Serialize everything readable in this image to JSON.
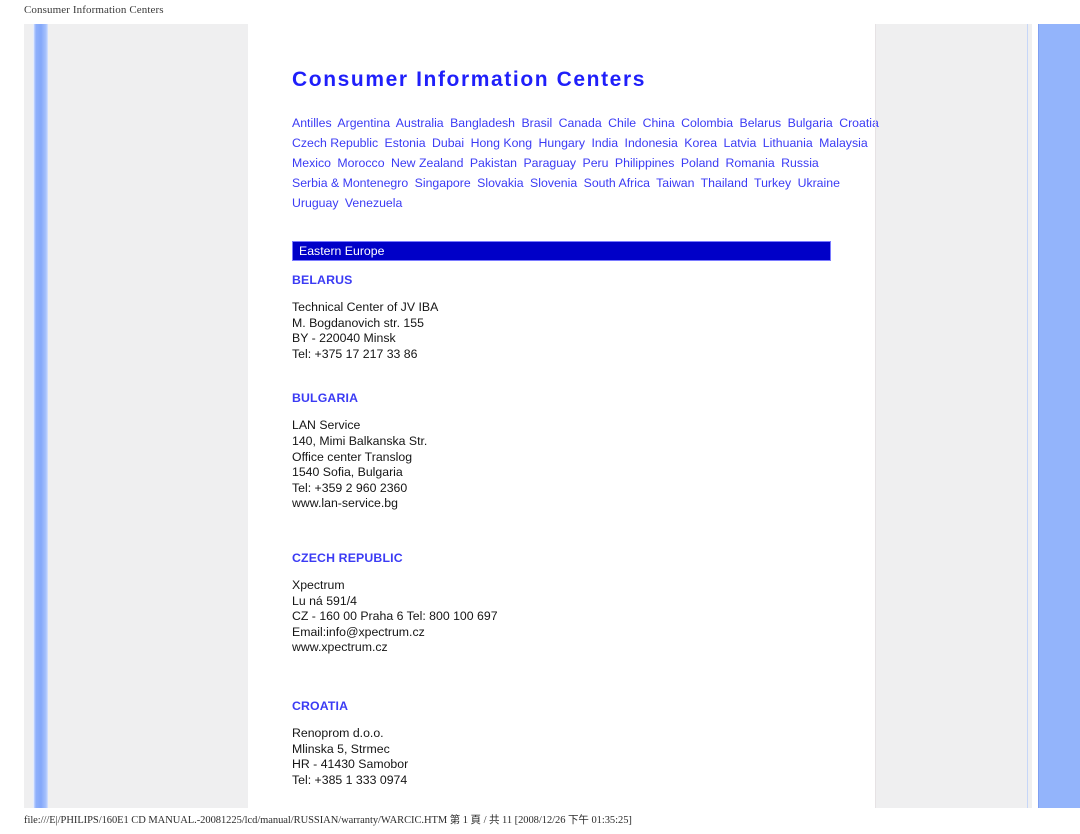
{
  "print_preview": {
    "header_title": "Consumer Information Centers",
    "footer_path": "file:///E|/PHILIPS/160E1 CD MANUAL.-20081225/lcd/manual/RUSSIAN/warranty/WARCIC.HTM 第 1 頁 / 共 11 [2008/12/26 下午 01:35:25]"
  },
  "colors": {
    "title_blue": "#1f1ffa",
    "link_blue": "#3b3bf4",
    "region_bar_bg": "#0000c8",
    "region_bar_text": "#ffffff",
    "body_text": "#151515",
    "page_bg": "#efeff0",
    "panel_bg": "#ffffff",
    "accent_bar": "#84a8fa",
    "right_band": "#93b4fb"
  },
  "document": {
    "title": "Consumer Information Centers",
    "country_links": [
      "Antilles",
      "Argentina",
      "Australia",
      "Bangladesh",
      "Brasil",
      "Canada",
      "Chile",
      "China",
      "Colombia",
      "Belarus",
      "Bulgaria",
      "Croatia",
      "Czech Republic",
      "Estonia",
      "Dubai",
      "Hong Kong",
      "Hungary",
      "India",
      "Indonesia",
      "Korea",
      "Latvia",
      "Lithuania",
      "Malaysia",
      "Mexico",
      "Morocco",
      "New Zealand",
      "Pakistan",
      "Paraguay",
      "Peru",
      "Philippines",
      "Poland",
      "Romania",
      "Russia",
      "Serbia & Montenegro",
      "Singapore",
      "Slovakia",
      "Slovenia",
      "South Africa",
      "Taiwan",
      "Thailand",
      "Turkey",
      "Ukraine",
      "Uruguay",
      "Venezuela"
    ],
    "region_bar_label": "Eastern Europe",
    "sections": [
      {
        "name": "BELARUS",
        "lines": [
          "Technical Center of JV IBA",
          "M. Bogdanovich str. 155",
          "BY - 220040 Minsk",
          "Tel: +375 17 217 33 86"
        ]
      },
      {
        "name": "BULGARIA",
        "lines": [
          "LAN Service",
          "140, Mimi Balkanska Str.",
          "Office center Translog",
          "1540 Sofia, Bulgaria",
          "Tel: +359 2 960 2360",
          "www.lan-service.bg"
        ]
      },
      {
        "name": "CZECH REPUBLIC",
        "lines": [
          "Xpectrum",
          "Lu ná 591/4",
          "CZ - 160 00 Praha 6 Tel: 800 100 697",
          "Email:info@xpectrum.cz",
          "www.xpectrum.cz"
        ]
      },
      {
        "name": "CROATIA",
        "lines": [
          "Renoprom d.o.o.",
          "Mlinska 5, Strmec",
          "HR - 41430 Samobor",
          "Tel: +385 1 333 0974"
        ]
      }
    ]
  }
}
